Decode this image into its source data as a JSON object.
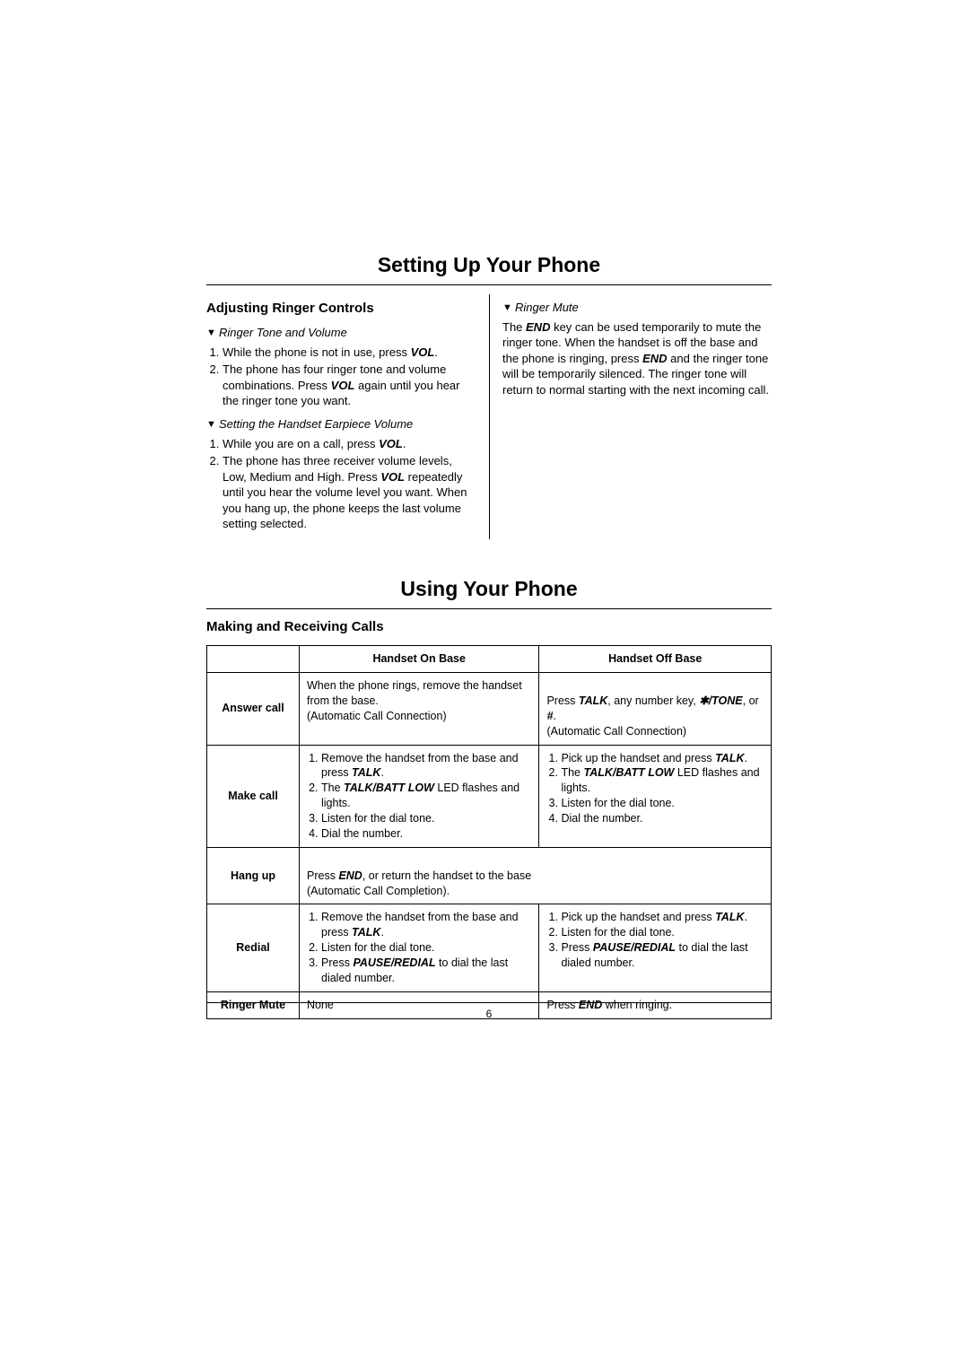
{
  "section1": {
    "title": "Setting Up Your Phone",
    "left": {
      "heading": "Adjusting Ringer Controls",
      "sub1": "Ringer Tone and Volume",
      "s1_li1_a": "While the phone is not in use, press ",
      "s1_li1_b": "VOL",
      "s1_li1_c": ".",
      "s1_li2_a": "The phone has four ringer tone and volume combinations. Press ",
      "s1_li2_b": "VOL",
      "s1_li2_c": " again until you hear the ringer tone you want.",
      "sub2": "Setting the Handset Earpiece Volume",
      "s2_li1_a": "While you are on a call, press ",
      "s2_li1_b": "VOL",
      "s2_li1_c": ".",
      "s2_li2_a": "The phone has three receiver volume levels, Low, Medium and High. Press ",
      "s2_li2_b": "VOL",
      "s2_li2_c": " repeatedly until you hear the volume level you want. When you hang up, the phone keeps the last volume setting selected."
    },
    "right": {
      "sub": "Ringer Mute",
      "p_a": "The ",
      "p_b": "END",
      "p_c": " key can be used temporarily to mute the ringer tone. When the handset is off the base and the phone is ringing, press ",
      "p_d": "END",
      "p_e": " and the ringer tone will be temporarily silenced. The ringer tone will return to normal starting with the next incoming call."
    }
  },
  "section2": {
    "title": "Using Your Phone",
    "heading": "Making and Receiving Calls",
    "headers": {
      "c1": "Handset On Base",
      "c2": "Handset Off Base"
    },
    "rows": {
      "answer": {
        "label": "Answer call",
        "on": "When the phone rings, remove the handset from the base.\n(Automatic Call Connection)",
        "off_a": "Press ",
        "off_b": "TALK",
        "off_c": ", any number key, ",
        "off_d": "✱/TONE",
        "off_e": ", or ",
        "off_f": "#",
        "off_g": ".\n(Automatic Call Connection)"
      },
      "make": {
        "label": "Make call",
        "on_li1_a": "Remove the handset from the base and press ",
        "on_li1_b": "TALK",
        "on_li1_c": ".",
        "on_li2_a": "The ",
        "on_li2_b": "TALK/BATT LOW",
        "on_li2_c": " LED flashes and lights.",
        "on_li3": "Listen for the dial tone.",
        "on_li4": "Dial the number.",
        "off_li1_a": "Pick up the handset and press ",
        "off_li1_b": "TALK",
        "off_li1_c": ".",
        "off_li2_a": "The ",
        "off_li2_b": "TALK/BATT LOW",
        "off_li2_c": " LED flashes and lights.",
        "off_li3": "Listen for the dial tone.",
        "off_li4": "Dial the number."
      },
      "hang": {
        "label": "Hang up",
        "text_a": "Press ",
        "text_b": "END",
        "text_c": ", or return the handset to the base\n(Automatic Call Completion)."
      },
      "redial": {
        "label": "Redial",
        "on_li1_a": "Remove the handset from the base and press ",
        "on_li1_b": "TALK",
        "on_li1_c": ".",
        "on_li2": "Listen for the dial tone.",
        "on_li3_a": "Press ",
        "on_li3_b": "PAUSE/REDIAL",
        "on_li3_c": " to dial the last dialed number.",
        "off_li1_a": "Pick up the handset and press ",
        "off_li1_b": "TALK",
        "off_li1_c": ".",
        "off_li2": "Listen for the dial tone.",
        "off_li3_a": "Press ",
        "off_li3_b": "PAUSE/REDIAL",
        "off_li3_c": " to dial the last dialed number."
      },
      "mute": {
        "label": "Ringer Mute",
        "on": "None",
        "off_a": "Press ",
        "off_b": "END",
        "off_c": " when ringing."
      }
    }
  },
  "page_number": "6"
}
